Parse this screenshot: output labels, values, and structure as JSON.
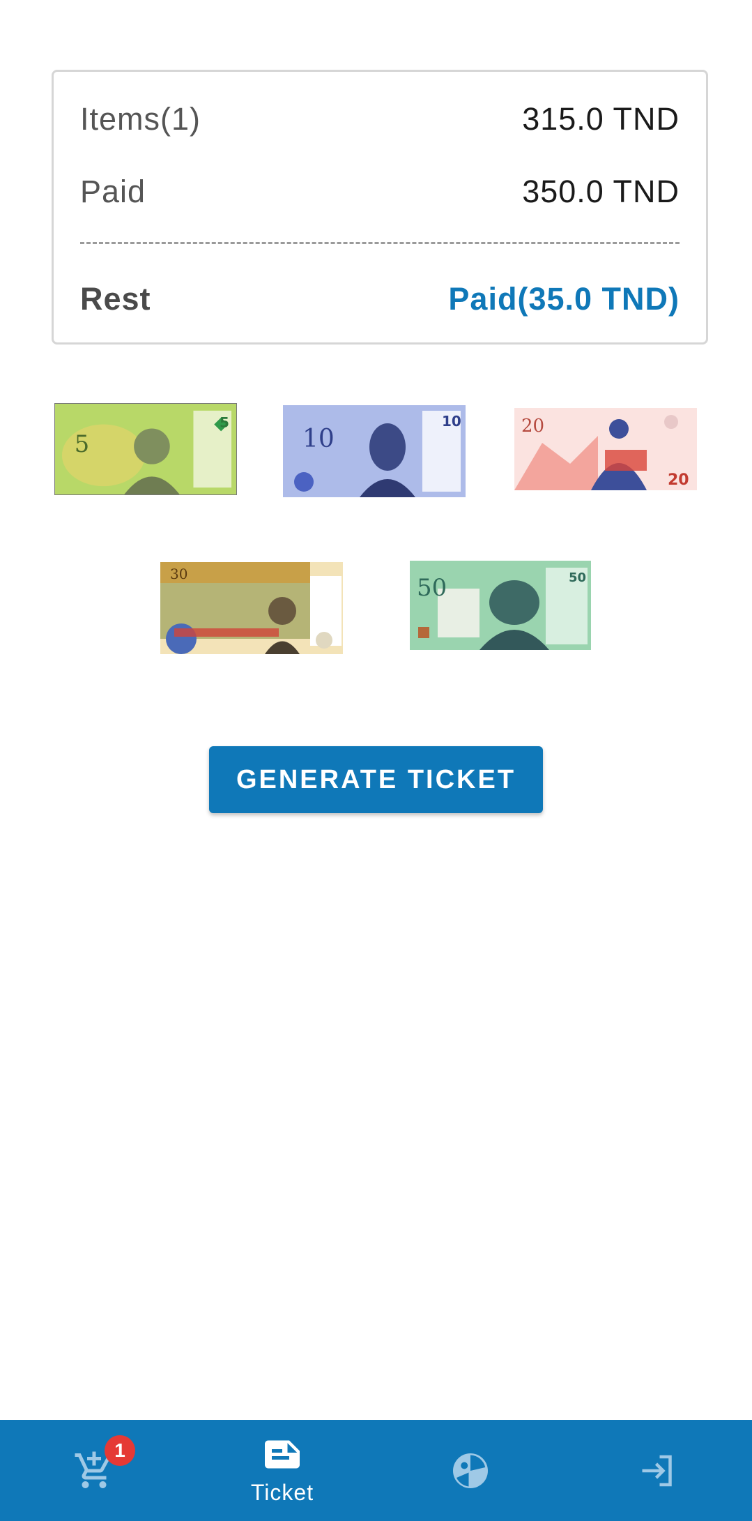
{
  "summary": {
    "items_label": "Items(1)",
    "items_value": "315.0 TND",
    "paid_label": "Paid",
    "paid_value": "350.0 TND",
    "rest_label": "Rest",
    "rest_value": "Paid(35.0 TND)"
  },
  "banknotes": [
    {
      "denomination": "5",
      "color": "#a9cf5a"
    },
    {
      "denomination": "10",
      "color": "#6f86d6"
    },
    {
      "denomination": "20",
      "color": "#f08a80"
    },
    {
      "denomination": "30",
      "color": "#c8a048"
    },
    {
      "denomination": "50",
      "color": "#6cbf8c"
    }
  ],
  "actions": {
    "generate_label": "GENERATE TICKET"
  },
  "bottom_nav": {
    "cart_icon": "add-shopping-cart-icon",
    "cart_badge": "1",
    "ticket_icon": "ticket-note-icon",
    "ticket_label": "Ticket",
    "stats_icon": "pie-chart-icon",
    "logout_icon": "login-arrow-icon"
  },
  "colors": {
    "accent": "#0f78b8",
    "badge": "#e53935",
    "card_border": "#d6d6d6"
  }
}
